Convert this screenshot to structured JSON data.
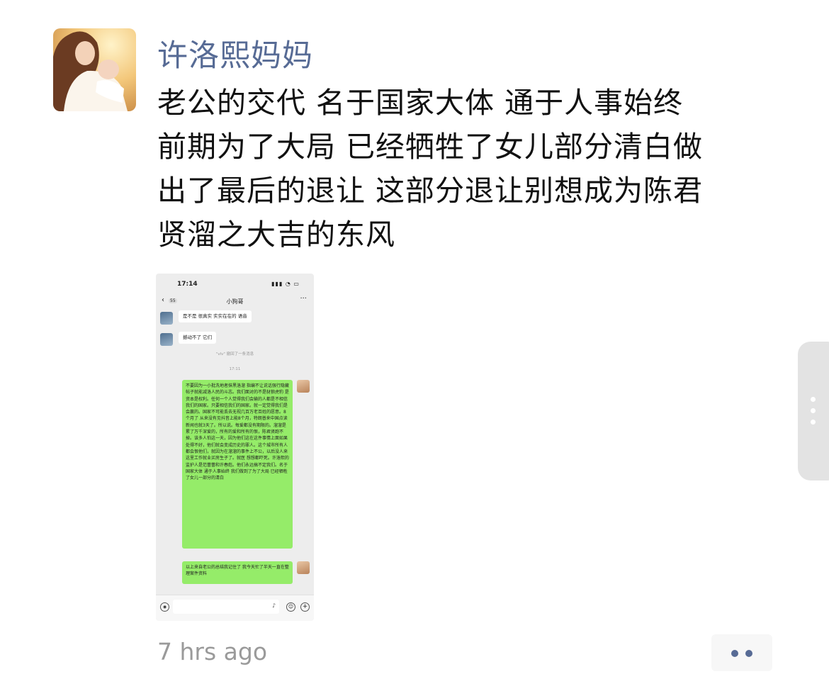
{
  "post": {
    "author": "许洛熙妈妈",
    "lines": [
      "老公的交代 名于国家大体 通于人事始终",
      "前期为了大局 已经牺牲了女儿部分清白做",
      "出了最后的退让 这部分退让别想成为陈君",
      "贤溜之大吉的东风"
    ],
    "timestamp": "7 hrs ago",
    "more_icon": "ellipsis-icon",
    "side_icon": "vertical-ellipsis-icon"
  },
  "screenshot": {
    "status_time": "17:14",
    "status_icons": "▮▮▮ ◔ ▭",
    "back_count": "55",
    "chat_title": "小狗哥",
    "messages": {
      "m1": "是不是 很真实 实实在在的 语音",
      "m2": "撼动不了 它们",
      "system": "\"vlv\" 撤回了一条消息",
      "time": "17:11",
      "m3": "不要因为一小批洗地者抹黑洛溜 指编不让说话强行隐藏帖子就能减洛人民的斗志。我们面对的不是豺狼虎豹 是资本是权利。任何一个人觉得我们会输的人都是不相信我们的国家。只要相信我们的国家。就一定觉得我们是会赢的。国家不可能丢去无视几百万老百姓的愿意。8个月了 从来没有见抖音上能8个月，特朗普来中国点读新闻也就3天了。所以说。每爱都没有期限的。溜溜是累了万千深爱的，所有的爱和所有的恨，陈君贤跑不掉。该多人怕这一天，因为他们这在这件事情上面如果处得不好，他们就会变成历史的罪人。这个城市所有人都会恨他们，就因为在溜溜的事件上不公，以后没人来这里工作就业买房生子了。就医 想想都吓死。许洛熙的监护人是范蕾蕾和许春彪。他们永远搞不定我们。名于国家大体 通于人事始终 我们做到了为了大局 已经牺牲了女儿一部分的清白",
      "m4": "以上来自老公的总结我记住了 我今天忙了半天一直在整理案件资料"
    }
  }
}
